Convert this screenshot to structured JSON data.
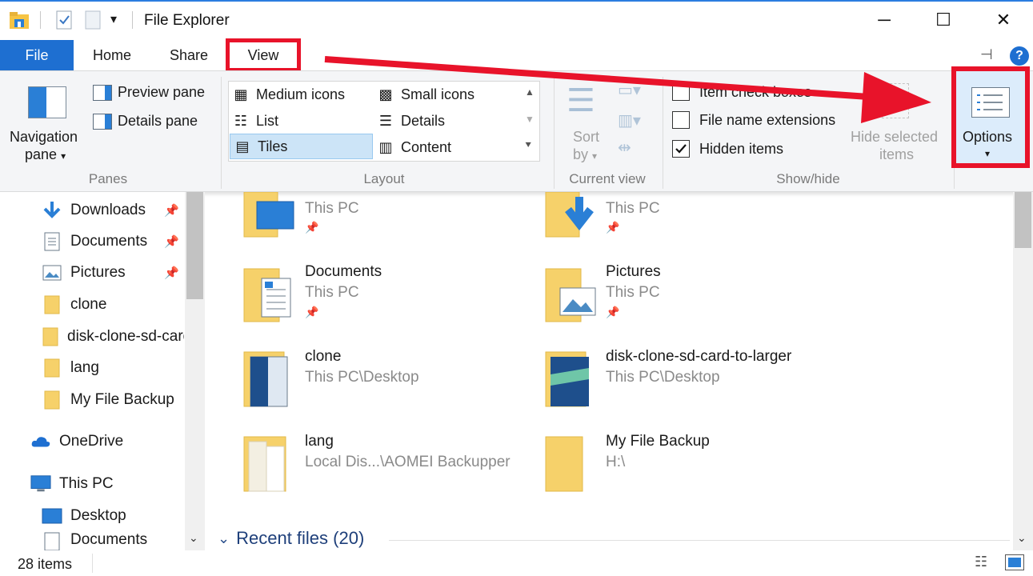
{
  "window": {
    "title": "File Explorer",
    "minimize": "─",
    "maximize": "☐",
    "close": "✕"
  },
  "tabs": {
    "file": "File",
    "home": "Home",
    "share": "Share",
    "view": "View"
  },
  "ribbon": {
    "panes": {
      "nav_line1": "Navigation",
      "nav_line2": "pane",
      "preview": "Preview pane",
      "details": "Details pane",
      "label": "Panes"
    },
    "layout": {
      "items": [
        "Medium icons",
        "Small icons",
        "List",
        "Details",
        "Tiles",
        "Content"
      ],
      "selected": "Tiles",
      "label": "Layout"
    },
    "current_view": {
      "sort_line1": "Sort",
      "sort_line2": "by",
      "label": "Current view"
    },
    "show_hide": {
      "item_check_boxes": "Item check boxes",
      "file_name_extensions": "File name extensions",
      "hidden_items": "Hidden items",
      "hide_selected_line1": "Hide selected",
      "hide_selected_line2": "items",
      "label": "Show/hide"
    },
    "options": "Options"
  },
  "nav": {
    "items": [
      "Downloads",
      "Documents",
      "Pictures",
      "clone",
      "disk-clone-sd-card-to-larger",
      "lang",
      "My File Backup",
      "OneDrive",
      "This PC",
      "Desktop",
      "Documents"
    ]
  },
  "content": {
    "tiles": [
      {
        "name": "",
        "path": "This PC"
      },
      {
        "name": "",
        "path": "This PC"
      },
      {
        "name": "Documents",
        "path": "This PC"
      },
      {
        "name": "Pictures",
        "path": "This PC"
      },
      {
        "name": "clone",
        "path": "This PC\\Desktop"
      },
      {
        "name": "disk-clone-sd-card-to-larger",
        "path": "This PC\\Desktop"
      },
      {
        "name": "lang",
        "path": "Local Dis...\\AOMEI Backupper"
      },
      {
        "name": "My File Backup",
        "path": "H:\\"
      }
    ],
    "recent_files": "Recent files (20)"
  },
  "status": {
    "item_count": "28 items"
  },
  "colors": {
    "accent": "#1e6fd1",
    "highlight_red": "#e8132a",
    "folder_yellow": "#f6d16a",
    "selected_bg": "#cce4f7"
  },
  "icons": [
    "folder-icon",
    "pin-icon",
    "download-arrow-icon",
    "onedrive-cloud-icon",
    "monitor-icon",
    "help-icon",
    "checkbox-icon"
  ]
}
